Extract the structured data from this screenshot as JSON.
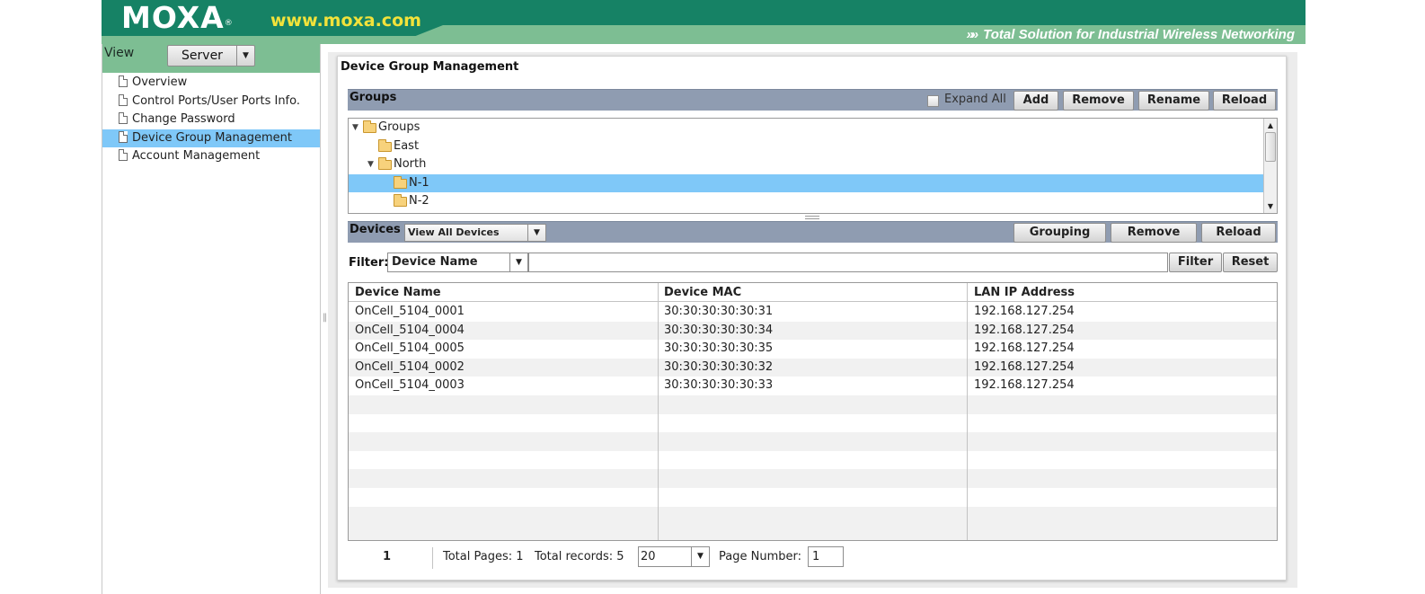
{
  "header": {
    "logo": "MOXA",
    "logo_mark": "®",
    "url": "www.moxa.com",
    "tagline_arrows": "»»",
    "tagline": "Total Solution for Industrial Wireless Networking"
  },
  "sidebar": {
    "view_label": "View",
    "server_select": "Server",
    "items": [
      {
        "label": "Overview",
        "active": false
      },
      {
        "label": "Control Ports/User Ports Info.",
        "active": false
      },
      {
        "label": "Change Password",
        "active": false
      },
      {
        "label": "Device Group Management",
        "active": true
      },
      {
        "label": "Account Management",
        "active": false
      }
    ]
  },
  "main": {
    "title": "Device Group Management",
    "groups": {
      "label": "Groups",
      "expand_all_label": "Expand All",
      "expand_all_checked": false,
      "buttons": {
        "add": "Add",
        "remove": "Remove",
        "rename": "Rename",
        "reload": "Reload"
      },
      "tree": [
        {
          "label": "Groups",
          "expanded": true,
          "selected": false
        },
        {
          "label": "East",
          "expanded": false,
          "selected": false
        },
        {
          "label": "North",
          "expanded": true,
          "selected": false
        },
        {
          "label": "N-1",
          "expanded": false,
          "selected": true
        },
        {
          "label": "N-2",
          "expanded": false,
          "selected": false
        }
      ]
    },
    "devices": {
      "label": "Devices",
      "view_select": "View All Devices",
      "buttons": {
        "grouping": "Grouping",
        "remove": "Remove",
        "reload": "Reload"
      }
    },
    "filter": {
      "label": "Filter:",
      "field_select": "Device Name",
      "value": "",
      "filter_button": "Filter",
      "reset_button": "Reset"
    },
    "table": {
      "columns": [
        "Device Name",
        "Device MAC",
        "LAN IP Address"
      ],
      "rows": [
        [
          "OnCell_5104_0001",
          "30:30:30:30:30:31",
          "192.168.127.254"
        ],
        [
          "OnCell_5104_0004",
          "30:30:30:30:30:34",
          "192.168.127.254"
        ],
        [
          "OnCell_5104_0005",
          "30:30:30:30:30:35",
          "192.168.127.254"
        ],
        [
          "OnCell_5104_0002",
          "30:30:30:30:30:32",
          "192.168.127.254"
        ],
        [
          "OnCell_5104_0003",
          "30:30:30:30:30:33",
          "192.168.127.254"
        ]
      ]
    },
    "pager": {
      "current_page": "1",
      "total_pages": "Total Pages: 1",
      "total_records": "Total records: 5",
      "page_size": "20",
      "page_number_label": "Page Number:",
      "page_number_value": "1"
    }
  },
  "colors": {
    "header_dark": "#168265",
    "header_light": "#7dbe93",
    "url_yellow": "#f2e23a",
    "selection": "#7fc8f8",
    "toolbar": "#8f9cb1"
  }
}
